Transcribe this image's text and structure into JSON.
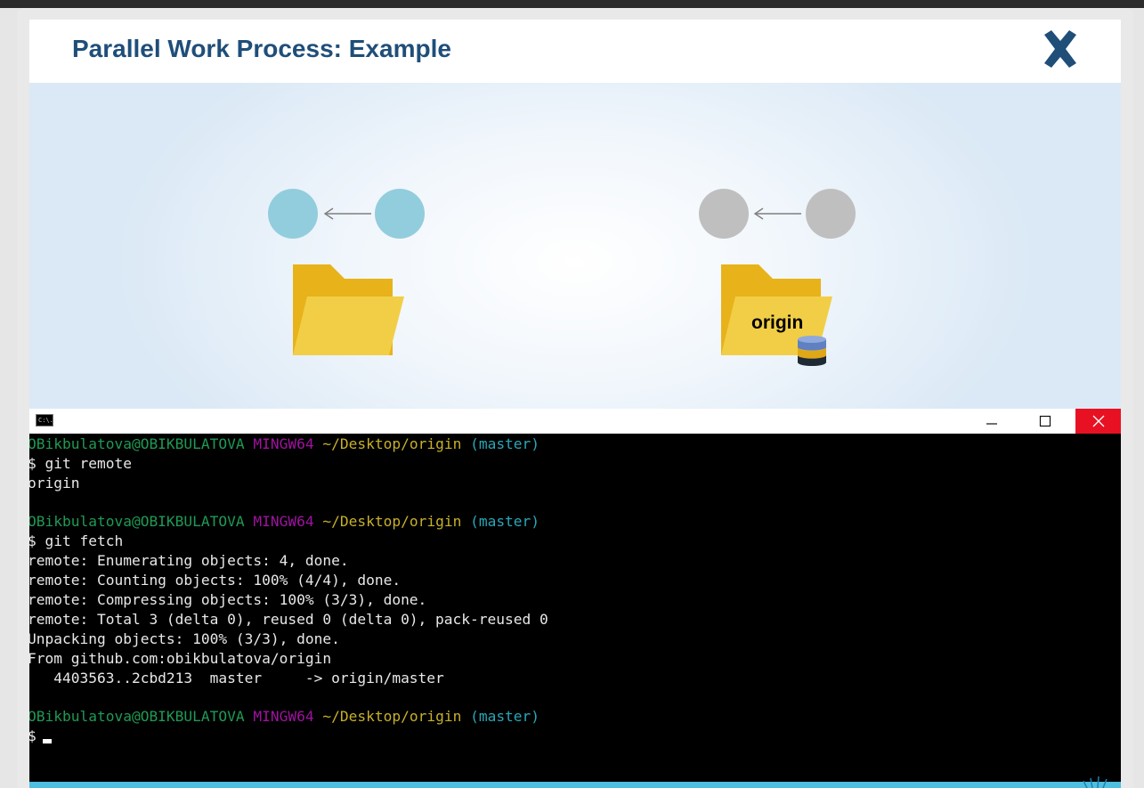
{
  "slide": {
    "title": "Parallel Work Process: Example",
    "accent_color": "#1f4e79",
    "close_icon": "close-x-icon"
  },
  "diagram": {
    "local": {
      "commit_color": "#92cddd",
      "folder_label": ""
    },
    "remote": {
      "commit_color": "#bfbfbf",
      "folder_label": "origin",
      "badge_icon": "database-icon"
    }
  },
  "terminal": {
    "window_icon": "cmd-icon",
    "icon_text": "C:\\.",
    "controls": [
      "minimize",
      "maximize",
      "close"
    ],
    "blocks": [
      {
        "prompt": {
          "user": "OBikbulatova@OBIKBULATOVA",
          "system": "MINGW64",
          "path": "~/Desktop/origin",
          "branch": "(master)"
        },
        "command": "$ git remote",
        "output": [
          "origin"
        ]
      },
      {
        "prompt": {
          "user": "OBikbulatova@OBIKBULATOVA",
          "system": "MINGW64",
          "path": "~/Desktop/origin",
          "branch": "(master)"
        },
        "command": "$ git fetch",
        "output": [
          "remote: Enumerating objects: 4, done.",
          "remote: Counting objects: 100% (4/4), done.",
          "remote: Compressing objects: 100% (3/3), done.",
          "remote: Total 3 (delta 0), reused 0 (delta 0), pack-reused 0",
          "Unpacking objects: 100% (3/3), done.",
          "From github.com:obikbulatova/origin",
          "   4403563..2cbd213  master     -> origin/master"
        ]
      },
      {
        "prompt": {
          "user": "OBikbulatova@OBIKBULATOVA",
          "system": "MINGW64",
          "path": "~/Desktop/origin",
          "branch": "(master)"
        },
        "command": "$",
        "output": []
      }
    ]
  }
}
